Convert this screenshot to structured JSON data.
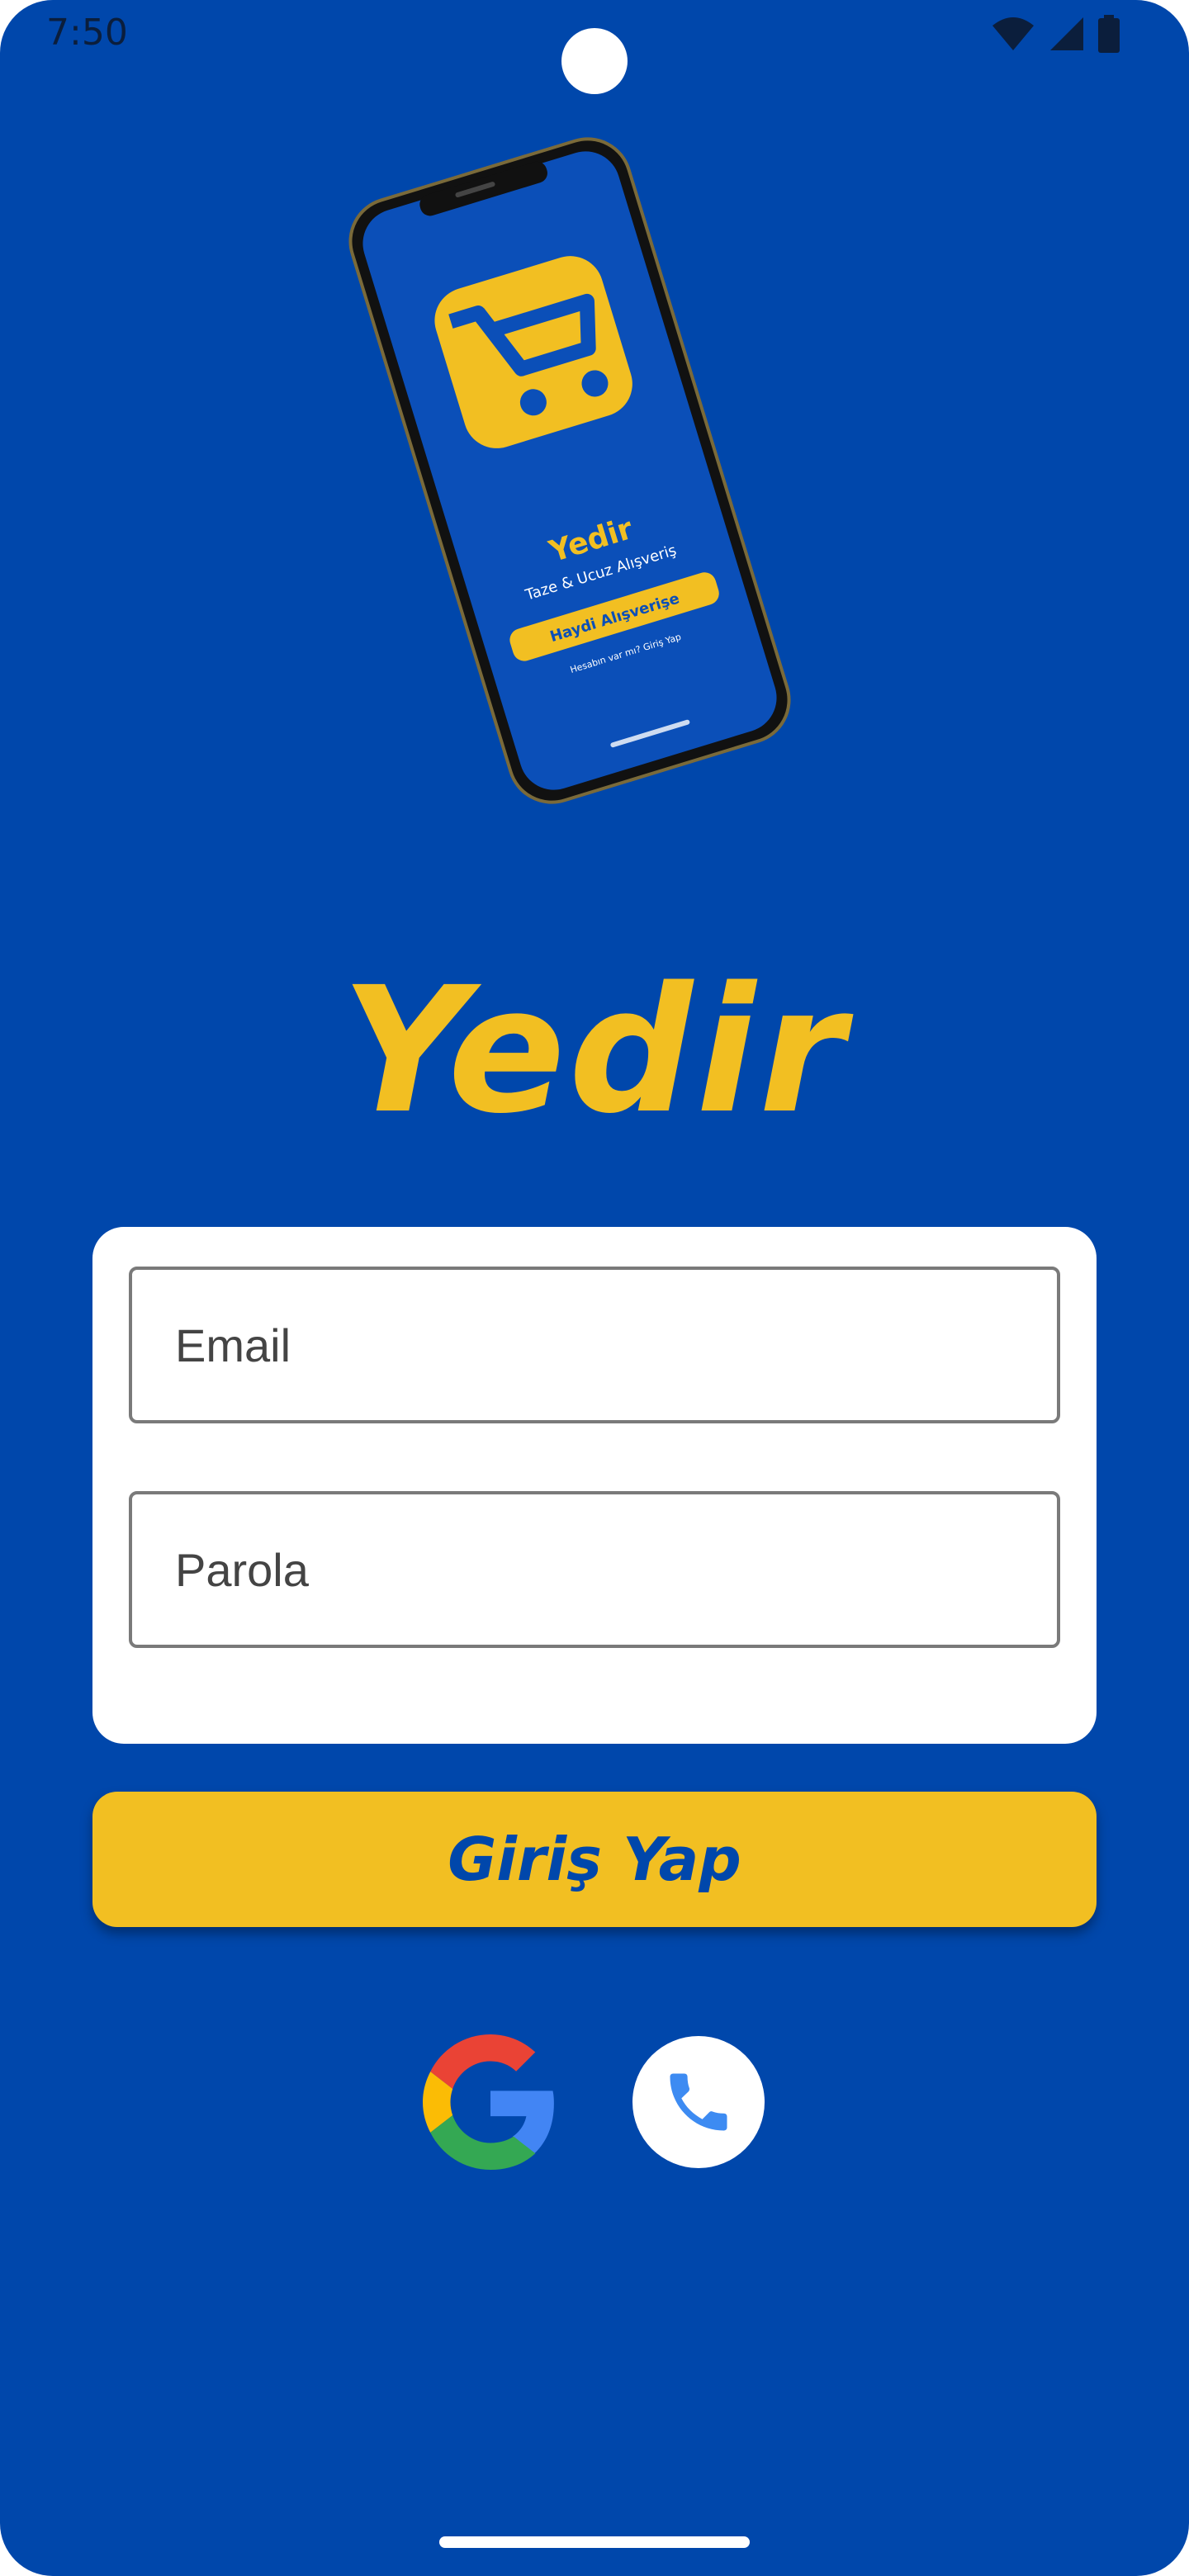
{
  "status_bar": {
    "time": "7:50"
  },
  "hero": {
    "app_name": "Yedir",
    "tagline": "Taze & Ucuz Alışveriş",
    "cta_label": "Haydi Alışverişe",
    "footer_text": "Hesabın var mı? Giriş Yap"
  },
  "title": "Yedir",
  "form": {
    "email_placeholder": "Email",
    "password_placeholder": "Parola"
  },
  "login_button_label": "Giriş Yap",
  "social": {
    "google_icon": "google-icon",
    "phone_icon": "phone-icon"
  },
  "colors": {
    "background": "#0047AB",
    "accent": "#F2BF22",
    "card": "#FFFFFF"
  }
}
